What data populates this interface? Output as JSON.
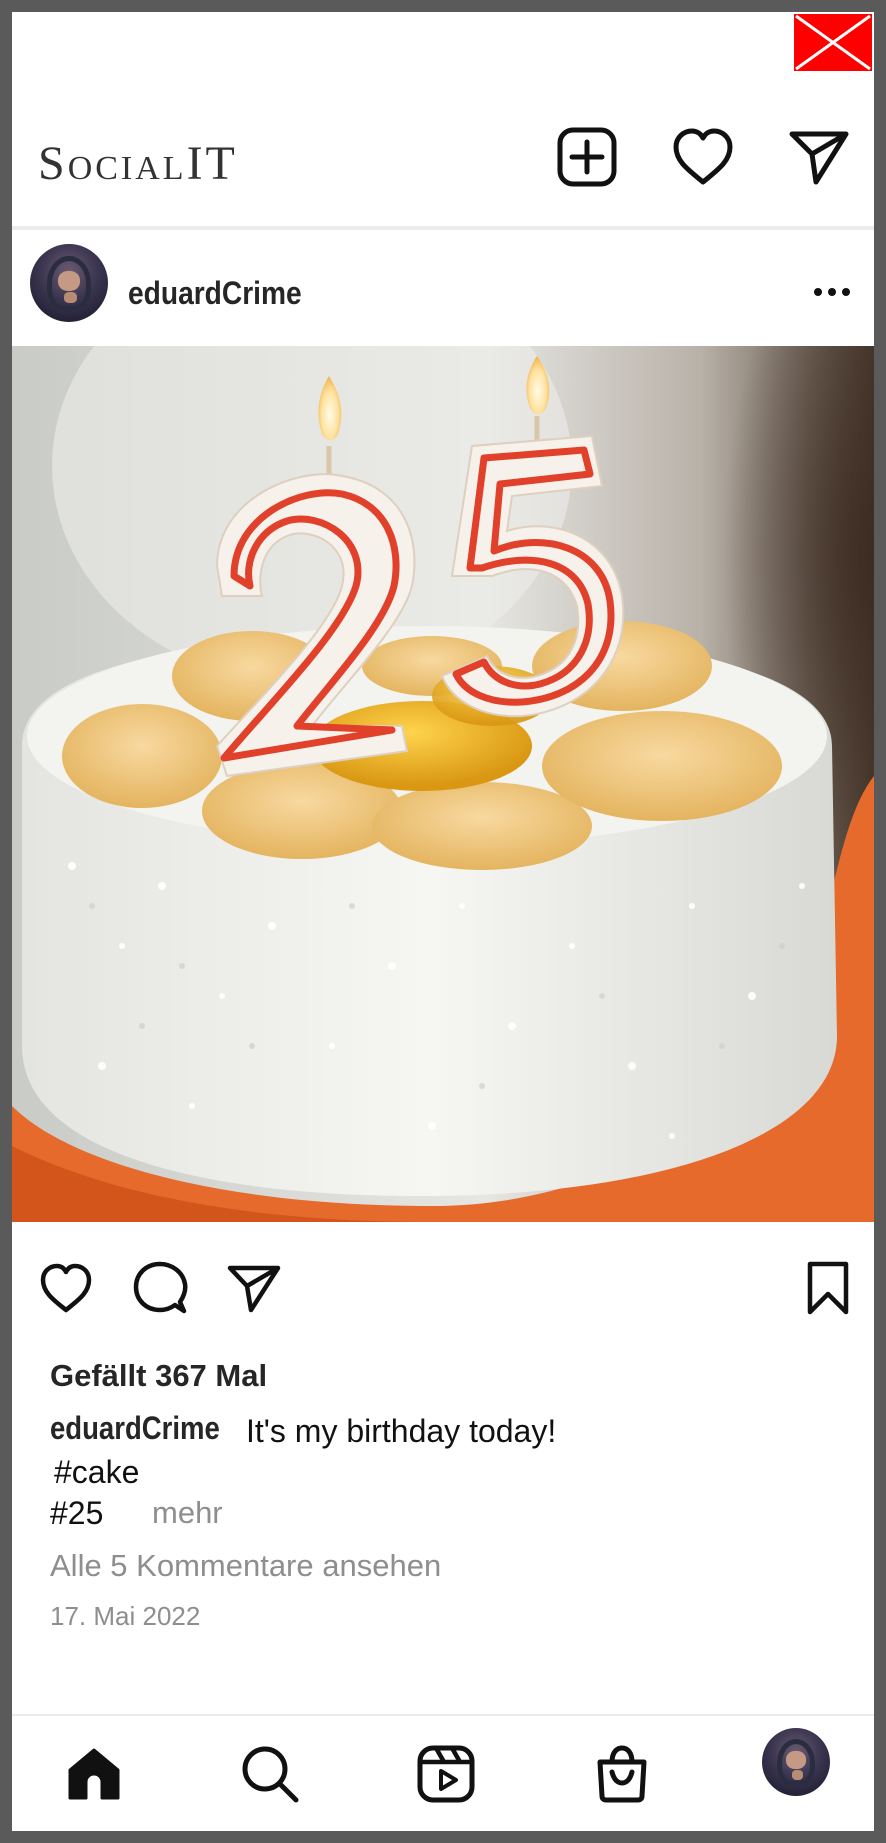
{
  "app": {
    "brand_name": "SocialIT",
    "brand_color": "#333333"
  },
  "header": {
    "icons": [
      "add-post-icon",
      "heart-icon",
      "send-icon"
    ]
  },
  "window": {
    "close_icon": "close-icon",
    "close_color": "#ff0000"
  },
  "post": {
    "username": "eduardCrime",
    "image_description_icon": "birthday-cake-photo",
    "likes": "Gefällt 367 Mal",
    "caption_user": "eduardCrime",
    "caption_text": "It's my birthday today!",
    "hashtag_1": "#cake",
    "hashtag_2": "#25",
    "more_label": "mehr",
    "comments_label": "Alle 5 Kommentare ansehen",
    "date": "17. Mai 2022",
    "actions": [
      "like-icon",
      "comment-icon",
      "share-icon",
      "bookmark-icon"
    ]
  },
  "bottom_nav": {
    "items": [
      "home-icon",
      "search-icon",
      "reels-icon",
      "shop-icon",
      "profile-avatar"
    ]
  }
}
